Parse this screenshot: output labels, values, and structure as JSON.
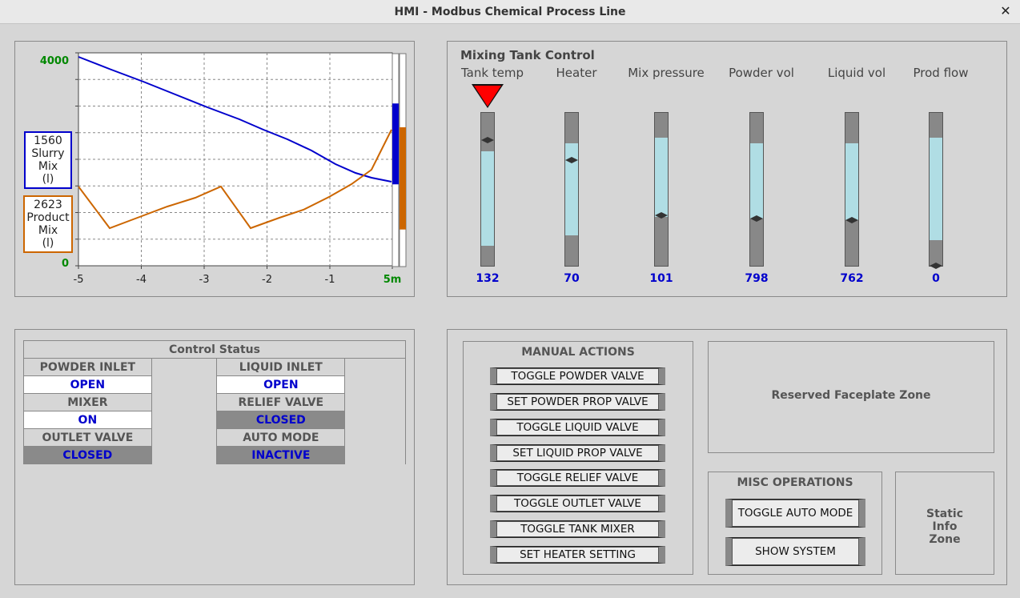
{
  "window": {
    "title": "HMI - Modbus Chemical Process Line",
    "close_label": "✕"
  },
  "trend": {
    "y_max_label": "4000",
    "y_min_label": "0",
    "x_ticks": [
      "-5",
      "-4",
      "-3",
      "-2",
      "-1",
      "5m"
    ],
    "legend_slurry": {
      "value": "1560",
      "line1": "Slurry",
      "line2": "Mix",
      "line3": "(l)"
    },
    "legend_product": {
      "value": "2623",
      "line1": "Product",
      "line2": "Mix",
      "line3": "(l)"
    },
    "colors": {
      "slurry": "#0000cc",
      "product": "#cc6600",
      "axis_label": "#008800"
    },
    "bar_levels": {
      "slurry": 0.39,
      "product": 0.66
    }
  },
  "tank": {
    "title": "Mixing Tank Control",
    "gauges": [
      {
        "label": "Tank temp",
        "value": "132",
        "fill_top": 0.25,
        "fill_bottom": 0.87,
        "marker": 0.18,
        "alarm": true
      },
      {
        "label": "Heater",
        "value": "70",
        "fill_top": 0.2,
        "fill_bottom": 0.8,
        "marker": 0.31,
        "alarm": false
      },
      {
        "label": "Mix pressure",
        "value": "101",
        "fill_top": 0.16,
        "fill_bottom": 0.68,
        "marker": 0.67,
        "alarm": false
      },
      {
        "label": "Powder vol",
        "value": "798",
        "fill_top": 0.2,
        "fill_bottom": 0.69,
        "marker": 0.69,
        "alarm": false
      },
      {
        "label": "Liquid vol",
        "value": "762",
        "fill_top": 0.2,
        "fill_bottom": 0.7,
        "marker": 0.7,
        "alarm": false
      },
      {
        "label": "Prod flow",
        "value": "0",
        "fill_top": 0.16,
        "fill_bottom": 0.83,
        "marker": 1.0,
        "alarm": false
      }
    ]
  },
  "control_status": {
    "title": "Control Status",
    "rows": [
      {
        "left_label": "POWDER INLET",
        "left_value": "OPEN",
        "left_state": "open",
        "right_label": "LIQUID INLET",
        "right_value": "OPEN",
        "right_state": "open"
      },
      {
        "left_label": "MIXER",
        "left_value": "ON",
        "left_state": "open",
        "right_label": "RELIEF VALVE",
        "right_value": "CLOSED",
        "right_state": "closed"
      },
      {
        "left_label": "OUTLET VALVE",
        "left_value": "CLOSED",
        "left_state": "closed",
        "right_label": "AUTO MODE",
        "right_value": "INACTIVE",
        "right_state": "closed"
      }
    ]
  },
  "manual_actions": {
    "title": "MANUAL ACTIONS",
    "buttons": [
      "TOGGLE POWDER VALVE",
      "SET POWDER PROP VALVE",
      "TOGGLE LIQUID VALVE",
      "SET LIQUID PROP VALVE",
      "TOGGLE RELIEF VALVE",
      "TOGGLE OUTLET VALVE",
      "TOGGLE TANK MIXER",
      "SET HEATER SETTING"
    ]
  },
  "reserved": {
    "label": "Reserved Faceplate Zone"
  },
  "misc": {
    "title": "MISC OPERATIONS",
    "buttons": [
      "TOGGLE AUTO MODE",
      "SHOW SYSTEM"
    ]
  },
  "static_zone": {
    "line1": "Static",
    "line2": "Info",
    "line3": "Zone"
  }
}
